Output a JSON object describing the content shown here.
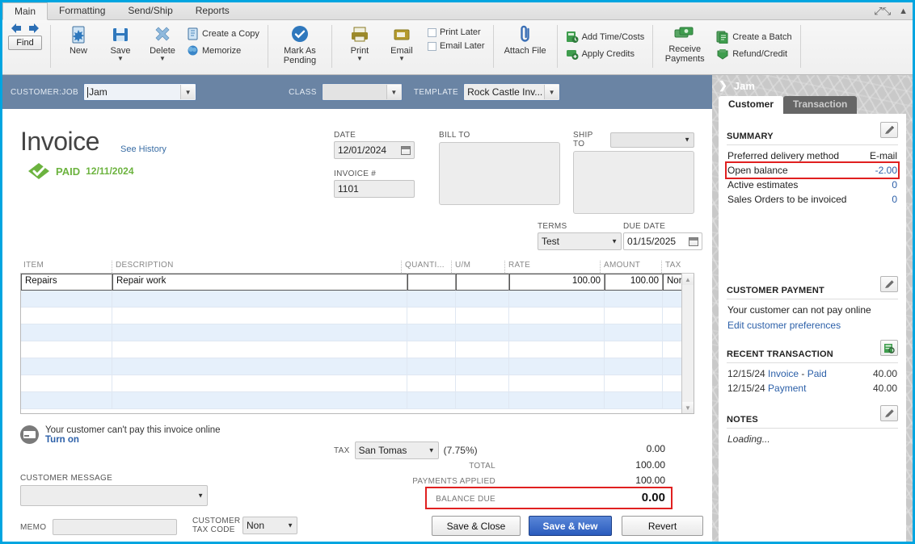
{
  "window": {
    "tabs": [
      {
        "label": "Main",
        "active": true
      },
      {
        "label": "Formatting",
        "active": false
      },
      {
        "label": "Send/Ship",
        "active": false
      },
      {
        "label": "Reports",
        "active": false
      }
    ],
    "expand_icon": "expand-icon",
    "collapse_icon": "chevron-up-icon"
  },
  "ribbon": {
    "find_label": "Find",
    "back_icon": "arrow-left-icon",
    "forward_icon": "arrow-right-icon",
    "buttons": [
      {
        "label": "New",
        "icon": "new-document-icon"
      },
      {
        "label": "Save",
        "icon": "save-disk-icon",
        "has_caret": true
      },
      {
        "label": "Delete",
        "icon": "delete-x-icon",
        "has_caret": true
      }
    ],
    "copy_label": "Create a Copy",
    "memorize_label": "Memorize",
    "mark_as_pending_label": "Mark As Pending",
    "print_label": "Print",
    "email_label": "Email",
    "print_later_label": "Print Later",
    "email_later_label": "Email Later",
    "attach_file_label": "Attach File",
    "add_time_costs_label": "Add Time/Costs",
    "apply_credits_label": "Apply Credits",
    "receive_payments_label": "Receive Payments",
    "create_batch_label": "Create a Batch",
    "refund_credit_label": "Refund/Credit"
  },
  "customer_bar": {
    "customer_job_label": "CUSTOMER:JOB",
    "customer_job_value": "Jam",
    "class_label": "CLASS",
    "class_value": "",
    "template_label": "TEMPLATE",
    "template_value": "Rock Castle Inv..."
  },
  "invoice": {
    "title": "Invoice",
    "see_history": "See History",
    "paid_badge": "PAID",
    "paid_date": "12/11/2024",
    "date_label": "DATE",
    "date_value": "12/01/2024",
    "invoice_no_label": "INVOICE #",
    "invoice_no_value": "1101",
    "bill_to_label": "BILL TO",
    "bill_to_value": "",
    "ship_to_label": "SHIP TO",
    "ship_to_value": "",
    "terms_label": "TERMS",
    "terms_value": "Test",
    "due_date_label": "DUE DATE",
    "due_date_value": "01/15/2025"
  },
  "line_items": {
    "columns": [
      "ITEM",
      "DESCRIPTION",
      "QUANTI...",
      "U/M",
      "RATE",
      "AMOUNT",
      "TAX"
    ],
    "rows": [
      {
        "item": "Repairs",
        "description": "Repair work",
        "quantity": "",
        "um": "",
        "rate": "100.00",
        "amount": "100.00",
        "tax": "Non"
      }
    ],
    "empty_row_count": 7
  },
  "footer": {
    "pay_online_text": "Your customer can't pay this invoice online",
    "turn_on_label": "Turn on",
    "customer_message_label": "CUSTOMER MESSAGE",
    "customer_message_value": "",
    "memo_label": "MEMO",
    "memo_value": "",
    "customer_tax_code_label": "CUSTOMER TAX CODE",
    "customer_tax_code_value": "Non",
    "tax_label": "TAX",
    "tax_value": "San Tomas",
    "tax_rate": "(7.75%)",
    "tax_amount": "0.00",
    "total_label": "TOTAL",
    "total_value": "100.00",
    "payments_applied_label": "PAYMENTS APPLIED",
    "payments_applied_value": "100.00",
    "balance_due_label": "BALANCE DUE",
    "balance_due_value": "0.00",
    "save_close_label": "Save & Close",
    "save_new_label": "Save & New",
    "revert_label": "Revert"
  },
  "sidebar": {
    "header_name": "Jam",
    "tab_customer": "Customer",
    "tab_transaction": "Transaction",
    "summary_heading": "SUMMARY",
    "summary_rows": [
      {
        "key": "Preferred delivery method",
        "value": "E-mail",
        "blue": false,
        "highlight": false
      },
      {
        "key": "Open balance",
        "value": "-2.00",
        "blue": true,
        "highlight": true
      },
      {
        "key": "Active estimates",
        "value": "0",
        "blue": true,
        "highlight": false
      },
      {
        "key": "Sales Orders to be invoiced",
        "value": "0",
        "blue": true,
        "highlight": false
      }
    ],
    "customer_payment_heading": "CUSTOMER PAYMENT",
    "customer_payment_text": "Your customer can not pay online",
    "edit_preferences_link": "Edit customer preferences",
    "recent_transaction_heading": "RECENT TRANSACTION",
    "recent_transactions": [
      {
        "date": "12/15/24",
        "type": "Invoice",
        "sep": "-",
        "status": "Paid",
        "amount": "40.00"
      },
      {
        "date": "12/15/24",
        "type": "Payment",
        "sep": "",
        "status": "",
        "amount": "40.00"
      }
    ],
    "notes_heading": "NOTES",
    "notes_text": "Loading..."
  },
  "colors": {
    "accent_blue": "#00a5e0",
    "customer_bar": "#6a84a4",
    "paid_green": "#6cb33f",
    "highlight_red": "#e02020",
    "link_blue": "#2b5fa8"
  }
}
